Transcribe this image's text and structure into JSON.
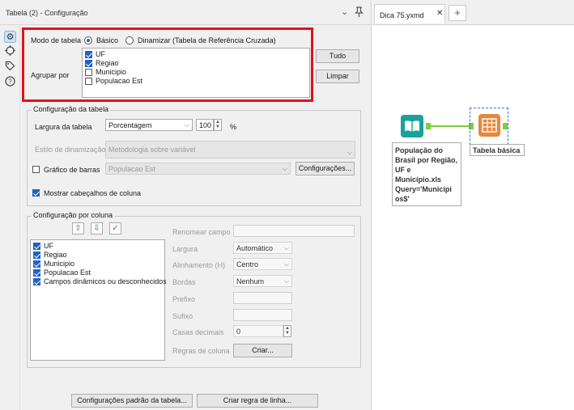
{
  "panel": {
    "title": "Tabela (2) - Configuração",
    "menu_icon": "chevron-down-icon",
    "pin_icon": "pin-icon"
  },
  "side_icons": [
    "gear-icon",
    "tool-icon",
    "tag-icon",
    "help-icon"
  ],
  "mode": {
    "label": "Modo de tabela",
    "basic": "Básico",
    "pivot": "Dinamizar (Tabela de Referência Cruzada)",
    "selected": "basic"
  },
  "group_by": {
    "label": "Agrupar por",
    "items": [
      {
        "label": "UF",
        "checked": true
      },
      {
        "label": "Regiao",
        "checked": true
      },
      {
        "label": "Municipio",
        "checked": false
      },
      {
        "label": "Populacao Est",
        "checked": false
      }
    ],
    "all_button": "Tudo",
    "clear_button": "Limpar"
  },
  "table_config": {
    "title": "Configuração da tabela",
    "width_label": "Largura da tabela",
    "width_mode": "Porcentagem",
    "width_value": "100",
    "width_unit": "%",
    "pivot_style_label": "Estilo de dinamização",
    "pivot_style_value": "Metodologia sobre variável",
    "bar_chart_label": "Gráfico de barras",
    "bar_chart_checked": false,
    "bar_chart_field": "Populacao Est",
    "settings_button": "Configurações...",
    "show_headers_label": "Mostrar cabeçalhos de coluna",
    "show_headers_checked": true
  },
  "column_config": {
    "title": "Configuração por coluna",
    "columns": [
      {
        "label": "UF",
        "checked": true
      },
      {
        "label": "Regiao",
        "checked": true
      },
      {
        "label": "Municipio",
        "checked": true
      },
      {
        "label": "Populacao Est",
        "checked": true
      },
      {
        "label": "Campos dinâmicos ou desconhecidos",
        "checked": true
      }
    ],
    "rename_label": "Renomear campo",
    "width_label": "Largura",
    "width_value": "Automático",
    "align_label": "Alinhamento (H)",
    "align_value": "Centro",
    "borders_label": "Bordas",
    "borders_value": "Nenhum",
    "prefix_label": "Prefixo",
    "suffix_label": "Sufixo",
    "decimals_label": "Casas decimais",
    "decimals_value": "0",
    "rules_label": "Regras de coluna",
    "create_button": "Criar..."
  },
  "footer": {
    "defaults_button": "Configurações padrão da tabela...",
    "row_rule_button": "Criar regra de linha..."
  },
  "canvas": {
    "tab_title": "Dica 75.yxmd",
    "add_tab": "+",
    "input_tool_label": [
      "População do",
      "Brasil por Região,",
      "UF e",
      "Município.xls",
      "Query='Municipi",
      "os$'"
    ],
    "table_tool_label": "Tabela básica",
    "input_color": "#17a398",
    "table_color": "#e8873c",
    "connector_color": "#7ccf3a"
  }
}
